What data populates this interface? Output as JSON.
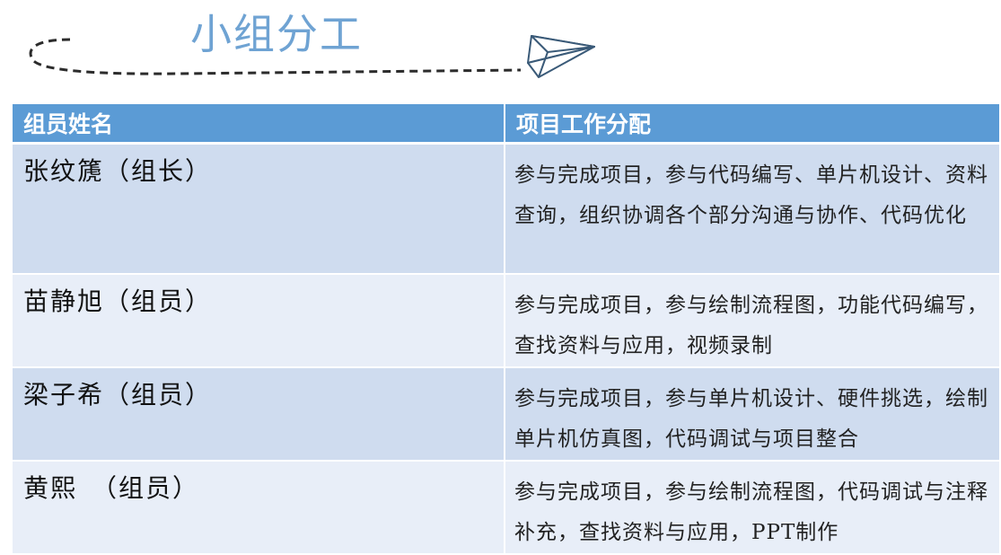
{
  "slide": {
    "title": "小组分工"
  },
  "table": {
    "headers": [
      "组员姓名",
      "项目工作分配"
    ],
    "rows": [
      {
        "name": "张纹篪（组长）",
        "desc": "参与完成项目，参与代码编写、单片机设计、资料查询，组织协调各个部分沟通与协作、代码优化"
      },
      {
        "name": "苗静旭（组员）",
        "desc": "参与完成项目，参与绘制流程图，功能代码编写，查找资料与应用，视频录制"
      },
      {
        "name": "梁子希（组员）",
        "desc": "参与完成项目，参与单片机设计、硬件挑选，绘制单片机仿真图，代码调试与项目整合"
      },
      {
        "name": "黄熙　（组员）",
        "desc": "参与完成项目，参与绘制流程图，代码调试与注释补充，查找资料与应用，PPT制作"
      }
    ]
  },
  "colors": {
    "header": "#5b9bd5",
    "row_dark": "#cfdcef",
    "row_light": "#e8eef8",
    "title": "#6fa3d3"
  }
}
